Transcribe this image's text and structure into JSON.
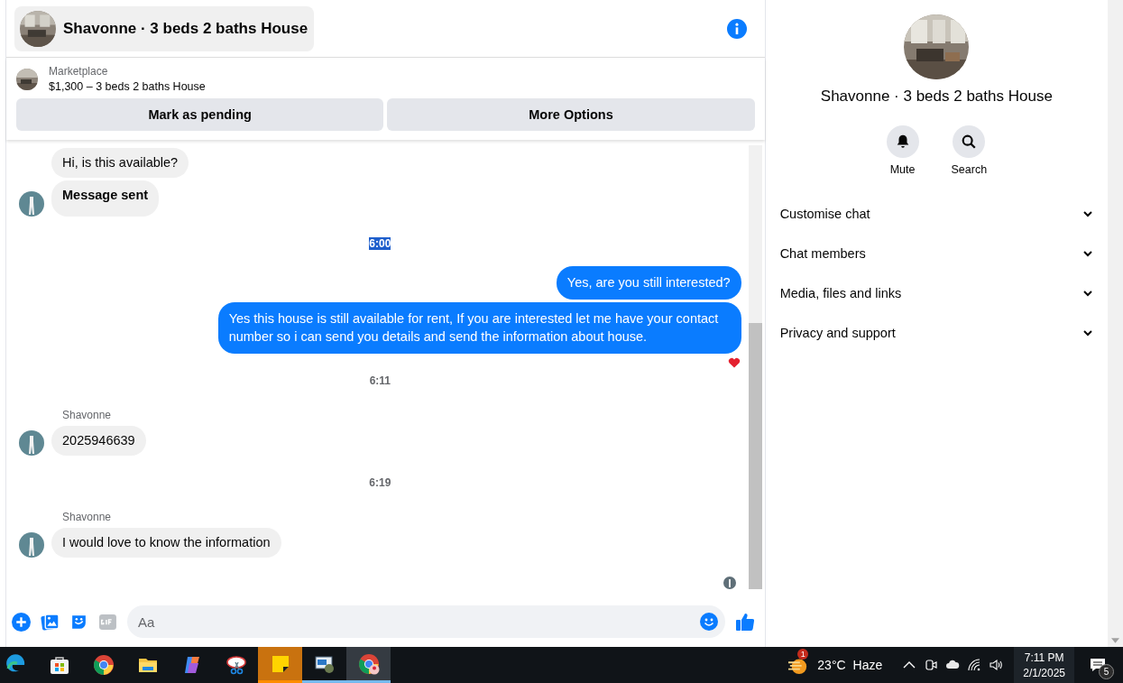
{
  "header": {
    "title": "Shavonne · 3 beds 2 baths House"
  },
  "listing": {
    "source": "Marketplace",
    "title": "$1,300 – 3 beds 2 baths House",
    "actions": [
      "Mark as pending",
      "More Options"
    ]
  },
  "messages": [
    {
      "kind": "received",
      "text": "Hi, is this available?",
      "bold": false,
      "avatar": false
    },
    {
      "kind": "received",
      "text": "Message sent",
      "bold": true,
      "avatar": true
    },
    {
      "kind": "time",
      "text": "6:00",
      "highlighted": true
    },
    {
      "kind": "sent",
      "text": "Yes, are you still interested?",
      "reaction": false
    },
    {
      "kind": "sent",
      "text": "Yes this house is still available for rent,  If you are interested  let me have your contact number so i can send you details and send the information about house.",
      "reaction": true
    },
    {
      "kind": "time",
      "text": "6:11",
      "highlighted": false
    },
    {
      "kind": "received",
      "sender": "Shavonne",
      "text": "2025946639",
      "bold": false,
      "avatar": true
    },
    {
      "kind": "time",
      "text": "6:19",
      "highlighted": false
    },
    {
      "kind": "received",
      "sender": "Shavonne",
      "text": "I would love to know the information",
      "bold": false,
      "avatar": true
    }
  ],
  "composer": {
    "placeholder": "Aa"
  },
  "side": {
    "title": "Shavonne · 3 beds 2 baths House",
    "actions": [
      {
        "kind": "bell",
        "label": "Mute"
      },
      {
        "kind": "search",
        "label": "Search"
      }
    ],
    "sections": [
      {
        "label": "Customise chat",
        "expanded": false
      },
      {
        "label": "Chat members",
        "expanded": false
      },
      {
        "label": "Media, files and links",
        "expanded": false
      },
      {
        "label": "Privacy and support",
        "expanded": false
      }
    ]
  },
  "taskbar": {
    "apps": [
      {
        "kind": "edge",
        "active": false,
        "running": false
      },
      {
        "kind": "store",
        "active": false,
        "running": false
      },
      {
        "kind": "chrome",
        "active": false,
        "running": false
      },
      {
        "kind": "folder",
        "active": false,
        "running": false
      },
      {
        "kind": "copilot",
        "active": false,
        "running": false
      },
      {
        "kind": "snip",
        "active": false,
        "running": false
      },
      {
        "kind": "notes",
        "active": true,
        "running": true
      },
      {
        "kind": "remote",
        "active": false,
        "running": true
      },
      {
        "kind": "chromeprofile",
        "active": true,
        "running": true
      }
    ],
    "weather": {
      "badge": "1",
      "temp": "23°C",
      "condition": "Haze"
    },
    "time": "7:11 PM",
    "date": "2/1/2025",
    "notifications": "5"
  }
}
